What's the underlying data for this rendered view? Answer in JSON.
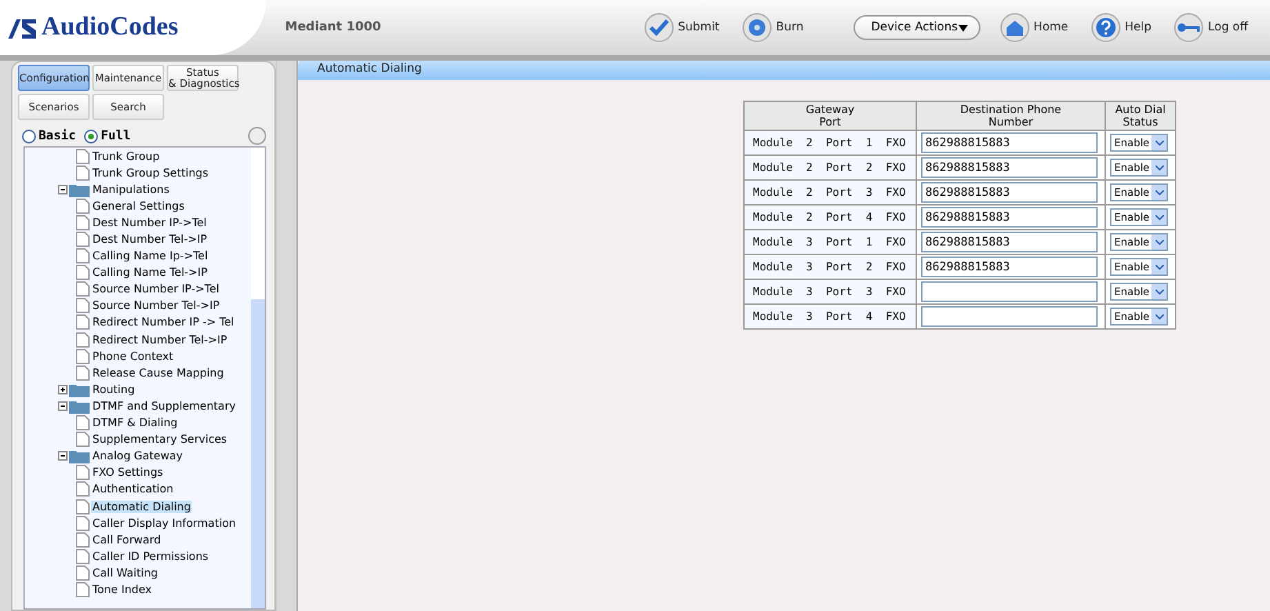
{
  "header": {
    "logo": "AudioCodes",
    "product": "Mediant 1000",
    "actions": [
      {
        "kind": "submit",
        "label": "Submit"
      },
      {
        "kind": "burn",
        "label": "Burn"
      },
      {
        "kind": "dropdown",
        "label": "Device Actions"
      },
      {
        "kind": "home",
        "label": "Home"
      },
      {
        "kind": "help",
        "label": "Help"
      },
      {
        "kind": "logoff",
        "label": "Log off"
      }
    ]
  },
  "nav_tabs": [
    {
      "label": "Configuration",
      "selected": true
    },
    {
      "label": "Maintenance",
      "selected": false
    },
    {
      "label": "Status\n& Diagnostics",
      "selected": false
    },
    {
      "label": "Scenarios",
      "selected": false
    },
    {
      "label": "Search",
      "selected": false
    }
  ],
  "view_modes": [
    {
      "label": "Basic",
      "selected": false
    },
    {
      "label": "Full",
      "selected": true
    }
  ],
  "tree": [
    {
      "kind": "page",
      "label": "Trunk Group",
      "selected": false
    },
    {
      "kind": "page",
      "label": "Trunk Group Settings",
      "selected": false
    },
    {
      "kind": "folder",
      "label": "Manipulations",
      "expanded": true,
      "children": [
        {
          "kind": "page",
          "label": "General Settings",
          "selected": false
        },
        {
          "kind": "page",
          "label": "Dest Number IP->Tel",
          "selected": false
        },
        {
          "kind": "page",
          "label": "Dest Number Tel->IP",
          "selected": false
        },
        {
          "kind": "page",
          "label": "Calling Name Ip->Tel",
          "selected": false
        },
        {
          "kind": "page",
          "label": "Calling Name Tel->IP",
          "selected": false
        },
        {
          "kind": "page",
          "label": "Source Number IP->Tel",
          "selected": false
        },
        {
          "kind": "page",
          "label": "Source Number Tel->IP",
          "selected": false
        },
        {
          "kind": "page",
          "label": "Redirect Number IP -> Tel",
          "selected": false
        },
        {
          "kind": "page",
          "label": "Redirect Number Tel->IP",
          "selected": false
        },
        {
          "kind": "page",
          "label": "Phone Context",
          "selected": false
        },
        {
          "kind": "page",
          "label": "Release Cause Mapping",
          "selected": false
        }
      ]
    },
    {
      "kind": "folder",
      "label": "Routing",
      "expanded": false
    },
    {
      "kind": "folder",
      "label": "DTMF and Supplementary",
      "expanded": true,
      "children": [
        {
          "kind": "page",
          "label": "DTMF & Dialing",
          "selected": false
        },
        {
          "kind": "page",
          "label": "Supplementary Services",
          "selected": false
        }
      ]
    },
    {
      "kind": "folder",
      "label": "Analog Gateway",
      "expanded": true,
      "children": [
        {
          "kind": "page",
          "label": "FXO Settings",
          "selected": false
        },
        {
          "kind": "page",
          "label": "Authentication",
          "selected": false
        },
        {
          "kind": "page",
          "label": "Automatic Dialing",
          "selected": true
        },
        {
          "kind": "page",
          "label": "Caller Display Information",
          "selected": false
        },
        {
          "kind": "page",
          "label": "Call Forward",
          "selected": false
        },
        {
          "kind": "page",
          "label": "Caller ID Permissions",
          "selected": false
        },
        {
          "kind": "page",
          "label": "Call Waiting",
          "selected": false
        },
        {
          "kind": "page",
          "label": "Tone Index",
          "selected": false
        }
      ]
    }
  ],
  "page_title": "Automatic Dialing",
  "table": {
    "columns": [
      "Gateway\nPort",
      "Destination Phone\nNumber",
      "Auto Dial\nStatus"
    ],
    "rows": [
      {
        "port": "Module  2  Port  1  FXO",
        "number": "862988815883",
        "status": "Enable"
      },
      {
        "port": "Module  2  Port  2  FXO",
        "number": "862988815883",
        "status": "Enable"
      },
      {
        "port": "Module  2  Port  3  FXO",
        "number": "862988815883",
        "status": "Enable"
      },
      {
        "port": "Module  2  Port  4  FXO",
        "number": "862988815883",
        "status": "Enable"
      },
      {
        "port": "Module  3  Port  1  FXO",
        "number": "862988815883",
        "status": "Enable"
      },
      {
        "port": "Module  3  Port  2  FXO",
        "number": "862988815883",
        "status": "Enable"
      },
      {
        "port": "Module  3  Port  3  FXO",
        "status": "Enable"
      },
      {
        "port": "Module  3  Port  4  FXO",
        "status": "Enable"
      }
    ]
  }
}
